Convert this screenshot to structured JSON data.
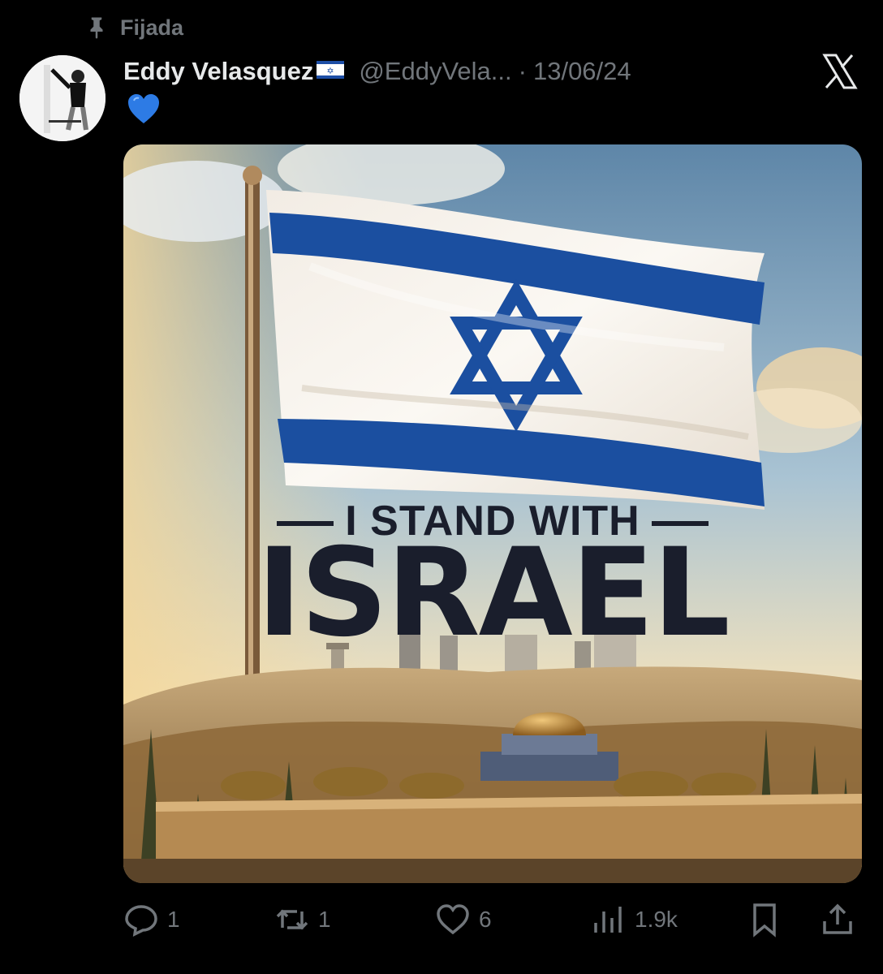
{
  "pinned": {
    "label": "Fijada",
    "icon": "pin-icon"
  },
  "tweet": {
    "author_name": "Eddy Velasquez",
    "author_flag": "🇮🇱",
    "handle": "@EddyVela...",
    "separator": "·",
    "date": "13/06/24",
    "text_emoji": "💙",
    "platform_icon": "x-logo-icon"
  },
  "media": {
    "line1": "I STAND WITH",
    "line2": "ISRAEL"
  },
  "actions": {
    "replies": "1",
    "reposts": "1",
    "likes": "6",
    "views": "1.9k"
  },
  "colors": {
    "background": "#000000",
    "secondary_text": "#71767b",
    "primary_text": "#e7e9ea",
    "flag_blue": "#1d4ea6",
    "heart_blue": "#2d7be5"
  }
}
